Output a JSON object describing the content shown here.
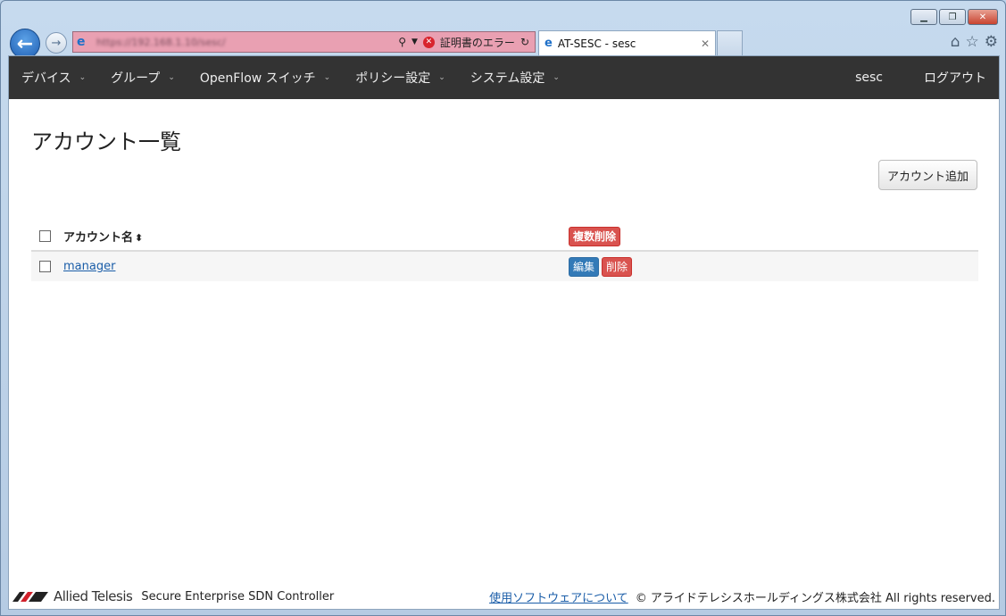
{
  "browser": {
    "address_url": "https://192.168.1.10/sesc/",
    "cert_error": "証明書のエラー",
    "tab_title": "AT-SESC - sesc"
  },
  "nav": {
    "items": [
      {
        "label": "デバイス"
      },
      {
        "label": "グループ"
      },
      {
        "label": "OpenFlow スイッチ"
      },
      {
        "label": "ポリシー設定"
      },
      {
        "label": "システム設定"
      }
    ],
    "user": "sesc",
    "logout": "ログアウト"
  },
  "page": {
    "title": "アカウント一覧",
    "add_button": "アカウント追加"
  },
  "table": {
    "header_name": "アカウント名",
    "bulk_delete": "複数削除",
    "rows": [
      {
        "name": "manager",
        "edit": "編集",
        "delete": "削除"
      }
    ]
  },
  "footer": {
    "brand": "Allied Telesis",
    "product": "Secure Enterprise SDN Controller",
    "about_link": "使用ソフトウェアについて",
    "copyright": "© アライドテレシスホールディングス株式会社 All rights reserved."
  }
}
